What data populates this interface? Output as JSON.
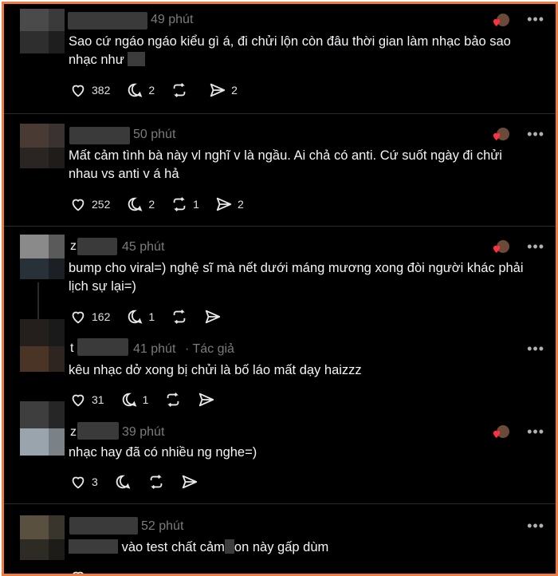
{
  "posts": [
    {
      "time": "49 phút",
      "text": "Sao cứ ngáo ngáo kiểu gì á, đi chửi lộn còn đâu thời gian làm nhạc bảo sao nhạc như",
      "likes": "382",
      "comments": "2",
      "reposts": "",
      "shares": "2"
    },
    {
      "time": "50 phút",
      "text": "Mất cảm tình bà này vl nghĩ v là ngầu. Ai chả có anti. Cứ suốt ngày đi chửi nhau vs anti v á hả",
      "likes": "252",
      "comments": "2",
      "reposts": "1",
      "shares": "2"
    },
    {
      "time": "45 phút",
      "name_initial": "z",
      "text": "bump cho viral=) nghệ sĩ mà nết dưới máng mương xong đòi người khác phải lịch sự lại=)",
      "likes": "162",
      "comments": "1",
      "reposts": "",
      "shares": ""
    },
    {
      "time": "41 phút",
      "name_initial": "t",
      "author_tag": "· Tác giả",
      "text": "kêu nhạc dở xong bị chửi là bố láo mất dạy haizzz",
      "likes": "31",
      "comments": "1",
      "reposts": "",
      "shares": ""
    },
    {
      "time": "39 phút",
      "name_initial": "z",
      "text": "nhạc hay đã có nhiều ng nghe=)",
      "likes": "3",
      "comments": "",
      "reposts": "",
      "shares": ""
    },
    {
      "time": "52 phút",
      "text_prefix": "",
      "text": "vào test chất cảm",
      "text_suffix": "on này gấp dùm",
      "likes": "",
      "comments": "",
      "reposts": "",
      "shares": ""
    }
  ],
  "more_label": "•••",
  "colors": {
    "accent_border": "#f07b3f",
    "liked_heart": "#ff3040"
  }
}
